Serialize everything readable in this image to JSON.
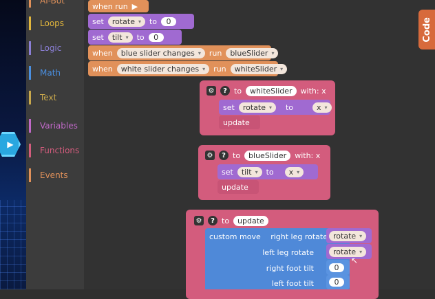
{
  "toolbox": {
    "categories": [
      {
        "label": "AI-Bot",
        "color": "#e1915a"
      },
      {
        "label": "Loops",
        "color": "#e3b73c"
      },
      {
        "label": "Logic",
        "color": "#8b7fd6"
      },
      {
        "label": "Math",
        "color": "#4a8fe0"
      },
      {
        "label": "Text",
        "color": "#c9a84c"
      },
      {
        "label": "Variables",
        "color": "#c069c8"
      },
      {
        "label": "Functions",
        "color": "#d35c7d"
      },
      {
        "label": "Events",
        "color": "#e1915a"
      }
    ]
  },
  "code_tab": {
    "label": "Code"
  },
  "blocks": {
    "when_run": "when run",
    "set1": {
      "kw": "set",
      "var": "rotate",
      "to": "to",
      "val": "0"
    },
    "set2": {
      "kw": "set",
      "var": "tilt",
      "to": "to",
      "val": "0"
    },
    "when1": {
      "kw": "when",
      "slider": "blue slider changes",
      "run": "run",
      "fn": "blueSlider"
    },
    "when2": {
      "kw": "when",
      "slider": "white slider changes",
      "run": "run",
      "fn": "whiteSlider"
    }
  },
  "fn_white": {
    "to": "to",
    "name": "whiteSlider",
    "with": "with: x",
    "set": "set",
    "var": "rotate",
    "to2": "to",
    "val": "x",
    "call": "update"
  },
  "fn_blue": {
    "to": "to",
    "name": "blueSlider",
    "with": "with: x",
    "set": "set",
    "var": "tilt",
    "to2": "to",
    "val": "x",
    "call": "update"
  },
  "fn_update": {
    "to": "to",
    "name": "update",
    "custom": "custom move",
    "rows": [
      {
        "label": "right leg rotate",
        "val": "rotate"
      },
      {
        "label": "left leg rotate",
        "val": "rotate"
      },
      {
        "label": "right foot tilt",
        "val": "0"
      },
      {
        "label": "left foot tilt",
        "val": "0"
      }
    ]
  }
}
